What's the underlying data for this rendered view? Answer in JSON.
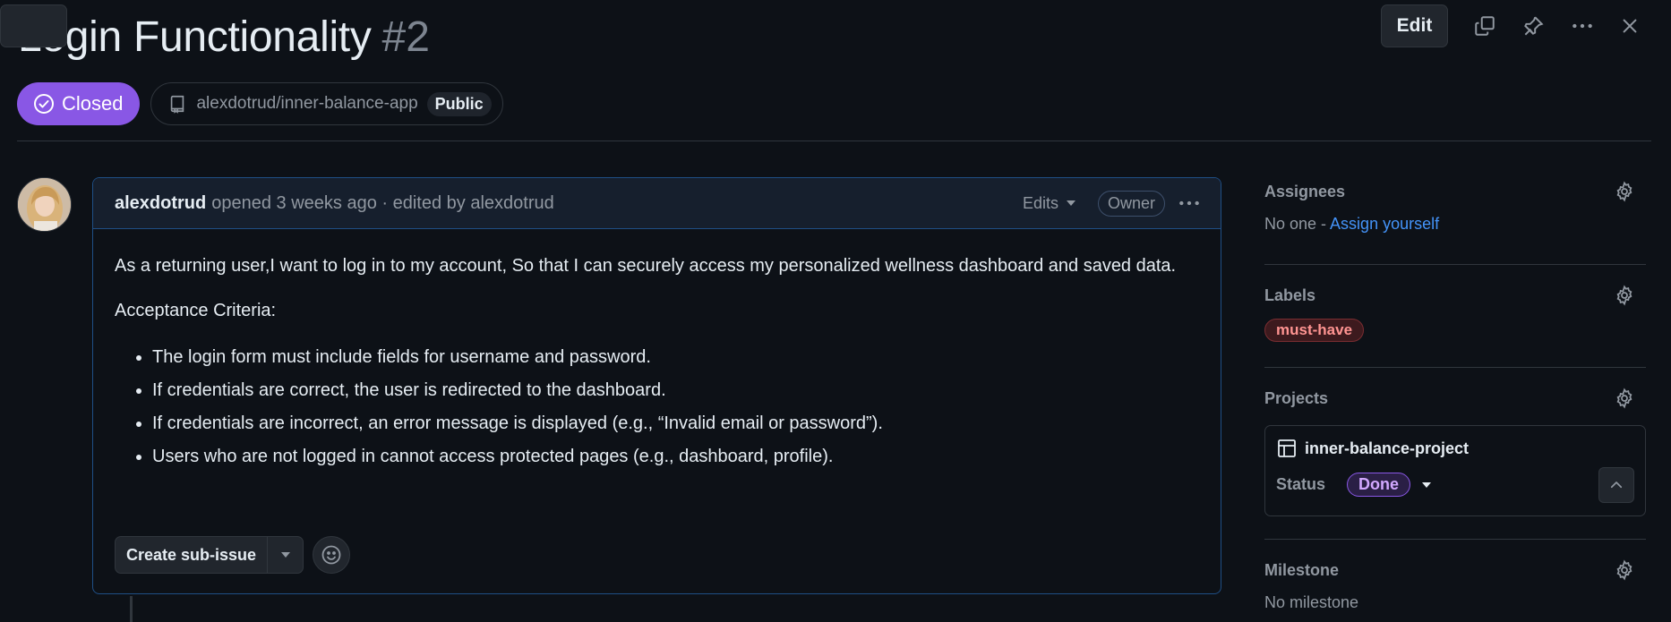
{
  "issue": {
    "title": "Login Functionality",
    "number": "#2",
    "state": "Closed",
    "repo": "alexdotrud/inner-balance-app",
    "visibility": "Public"
  },
  "toolbar": {
    "edit_label": "Edit",
    "icons": [
      "copy-icon",
      "pin-icon",
      "kebab-icon",
      "close-icon"
    ]
  },
  "comment": {
    "author": "alexdotrud",
    "meta": "opened 3 weeks ago · edited by alexdotrud",
    "edits_label": "Edits",
    "role_badge": "Owner",
    "paragraph1": "As a returning user,I want to log in to my account, So that I can securely access my personalized wellness dashboard and saved data.",
    "paragraph2": "Acceptance Criteria:",
    "criteria": [
      "The login form must include fields for username and password.",
      "If credentials are correct, the user is redirected to the dashboard.",
      "If credentials are incorrect, an error message is displayed (e.g., “Invalid email or password”).",
      "Users who are not logged in cannot access protected pages (e.g., dashboard, profile)."
    ],
    "create_sub_issue_label": "Create sub-issue"
  },
  "sidebar": {
    "assignees": {
      "heading": "Assignees",
      "value": "No one - ",
      "link": "Assign yourself"
    },
    "labels": {
      "heading": "Labels",
      "items": [
        "must-have"
      ]
    },
    "projects": {
      "heading": "Projects",
      "project_name": "inner-balance-project",
      "status_label": "Status",
      "status_value": "Done"
    },
    "milestone": {
      "heading": "Milestone",
      "value": "No milestone"
    }
  },
  "colors": {
    "background": "#0d1117",
    "closed_badge": "#8957e5",
    "link": "#4493f8",
    "label_must_have": "#ff9492",
    "done_badge": "#d2a8ff"
  }
}
